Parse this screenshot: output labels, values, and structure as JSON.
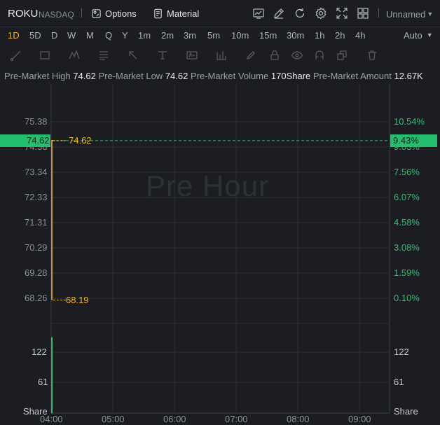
{
  "header": {
    "ticker": "ROKU",
    "exchange": "NASDAQ",
    "options_label": "Options",
    "material_label": "Material",
    "layout_name": "Unnamed",
    "icons": [
      "chart-type-icon",
      "draw-icon",
      "refresh-icon",
      "settings-icon",
      "fullscreen-icon",
      "grid-layout-icon"
    ]
  },
  "intervals": {
    "items": [
      "1D",
      "5D",
      "D",
      "W",
      "M",
      "Q",
      "Y",
      "1m",
      "2m",
      "3m",
      "5m",
      "10m",
      "15m",
      "30m",
      "1h",
      "2h",
      "4h"
    ],
    "active": "1D",
    "mode": "Auto"
  },
  "info": {
    "high_label": "Pre-Market High",
    "high_value": "74.62",
    "low_label": "Pre-Market Low",
    "low_value": "74.62",
    "volume_label": "Pre-Market Volume",
    "volume_value": "170Share",
    "amount_label": "Pre-Market Amount",
    "amount_value": "12.67K"
  },
  "chart": {
    "watermark": "Pre Hour",
    "price_ticks": [
      "75.38",
      "74.36",
      "73.34",
      "72.33",
      "71.31",
      "70.29",
      "69.28",
      "68.26"
    ],
    "pct_ticks": [
      "10.54%",
      "9.03%",
      "7.56%",
      "6.07%",
      "4.58%",
      "3.08%",
      "1.59%",
      "0.10%"
    ],
    "current_price_badge": "74.62",
    "current_pct_badge": "9.43%",
    "high_marker": "74.62",
    "low_marker": "68.19",
    "volume_ticks": [
      "122",
      "61",
      "Share"
    ],
    "volume_ticks_right": [
      "122",
      "61",
      "Share"
    ],
    "time_ticks": [
      "04:00",
      "05:00",
      "06:00",
      "07:00",
      "08:00",
      "09:00"
    ],
    "colors": {
      "up": "#22c06d",
      "line": "#f3b623",
      "badge": "#22c06d"
    }
  },
  "chart_data": {
    "type": "line",
    "title": "",
    "x": [
      "04:00",
      "04:00"
    ],
    "series": [
      {
        "values": [
          68.19,
          74.62
        ]
      }
    ],
    "ylim": [
      68.26,
      75.38
    ],
    "xlabel": "",
    "ylabel": "",
    "volume": {
      "x": [
        "04:00"
      ],
      "values": [
        170
      ]
    },
    "x_range": [
      "04:00",
      "09:00"
    ]
  }
}
